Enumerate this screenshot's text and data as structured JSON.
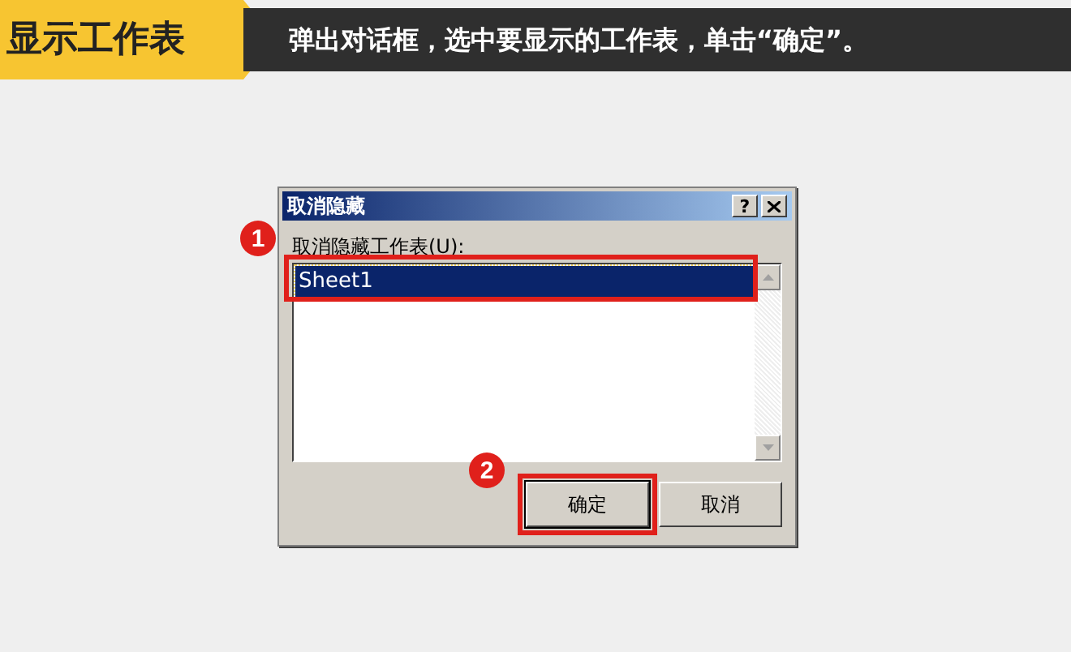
{
  "header": {
    "tag": "显示工作表",
    "instruction": "弹出对话框，选中要显示的工作表，单击“确定”。"
  },
  "dialog": {
    "title": "取消隐藏",
    "help": "?",
    "label": "取消隐藏工作表(U):",
    "items": [
      {
        "text": "Sheet1",
        "selected": true
      }
    ],
    "buttons": [
      {
        "label": "确定",
        "highlighted": true
      },
      {
        "label": "取消",
        "highlighted": false
      }
    ]
  },
  "callouts": [
    "1",
    "2"
  ]
}
